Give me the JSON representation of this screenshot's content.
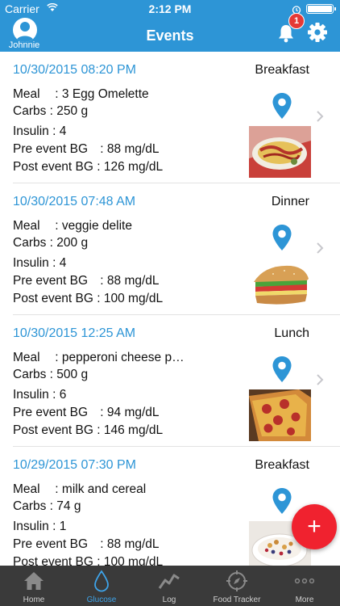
{
  "status_bar": {
    "carrier": "Carrier",
    "time": "2:12 PM"
  },
  "header": {
    "title": "Events",
    "user_name": "Johnnie",
    "notification_count": "1"
  },
  "events": [
    {
      "datetime": "10/30/2015 08:20 PM",
      "type": "Breakfast",
      "meal_label": "Meal",
      "meal": "3  Egg   Omelette",
      "carbs_label": "Carbs",
      "carbs": "250 g",
      "insulin_label": "Insulin",
      "insulin": "4",
      "pre_label": "Pre event BG",
      "pre": "88 mg/dL",
      "post_label": "Post event BG",
      "post": "126 mg/dL",
      "photo": "omelette"
    },
    {
      "datetime": "10/30/2015 07:48 AM",
      "type": "Dinner",
      "meal_label": "Meal",
      "meal": "veggie  delite",
      "carbs_label": "Carbs",
      "carbs": "200 g",
      "insulin_label": "Insulin",
      "insulin": "4",
      "pre_label": "Pre event BG",
      "pre": "88 mg/dL",
      "post_label": "Post event BG",
      "post": "100 mg/dL",
      "photo": "sandwich"
    },
    {
      "datetime": "10/30/2015 12:25 AM",
      "type": "Lunch",
      "meal_label": "Meal",
      "meal": "pepperoni cheese p…",
      "carbs_label": "Carbs",
      "carbs": "500 g",
      "insulin_label": "Insulin",
      "insulin": "6",
      "pre_label": "Pre event BG",
      "pre": "94 mg/dL",
      "post_label": "Post event BG",
      "post": "146 mg/dL",
      "photo": "pizza"
    },
    {
      "datetime": "10/29/2015 07:30 PM",
      "type": "Breakfast",
      "meal_label": "Meal",
      "meal": "milk and cereal",
      "carbs_label": "Carbs",
      "carbs": "74 g",
      "insulin_label": "Insulin",
      "insulin": "1",
      "pre_label": "Pre event BG",
      "pre": "88 mg/dL",
      "post_label": "Post event BG",
      "post": "100 mg/dL",
      "photo": "cereal"
    }
  ],
  "fab_label": "+",
  "tabs": [
    {
      "label": "Home",
      "icon": "home-icon"
    },
    {
      "label": "Glucose",
      "icon": "drop-icon",
      "active": true
    },
    {
      "label": "Log",
      "icon": "chart-icon"
    },
    {
      "label": "Food Tracker",
      "icon": "compass-icon"
    },
    {
      "label": "More",
      "icon": "more-icon"
    }
  ],
  "colors": {
    "header": "#2d95d6",
    "date_text": "#2d95d6",
    "fab": "#f0222f",
    "tabbar": "#3a3a3a",
    "active_tab": "#3ea4ea",
    "badge": "#e53935"
  }
}
